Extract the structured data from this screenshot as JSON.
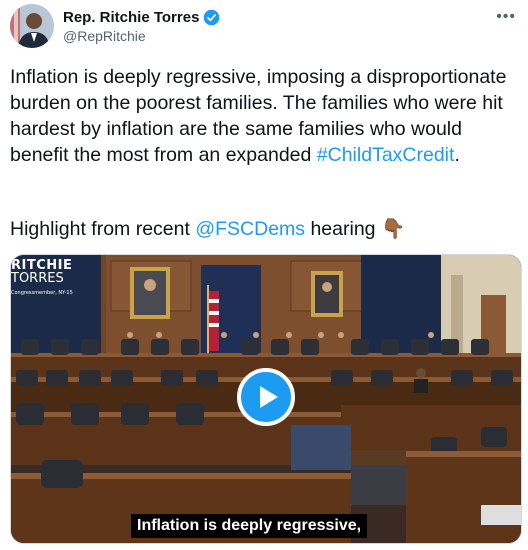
{
  "author": {
    "name": "Rep. Ritchie Torres",
    "handle": "@RepRitchie"
  },
  "icons": {
    "verified": "verified-badge-icon",
    "more": "more-options-icon",
    "play": "play-icon",
    "pointing_down": "backhand-index-pointing-down-emoji"
  },
  "tweet": {
    "text": "Inflation is deeply regressive, imposing a disproportionate burden on the poorest families. The families who were hit hardest by inflation are the same families who would benefit the most from an expanded ",
    "hashtag": "#ChildTaxCredit",
    "hashtag_suffix": ".",
    "highlight_prefix": "Highlight from recent ",
    "mention": "@FSCDems",
    "highlight_suffix": " hearing ",
    "emoji": "👇🏾"
  },
  "video": {
    "overlay_line1": "RITCHIE",
    "overlay_line2": "TORRES",
    "overlay_line3": "Congressmember, NY-15",
    "caption": "Inflation is deeply regressive,"
  },
  "colors": {
    "link": "#1d9bf0",
    "text": "#0f1419",
    "secondary": "#536471",
    "play_button": "#1d9bf0"
  }
}
